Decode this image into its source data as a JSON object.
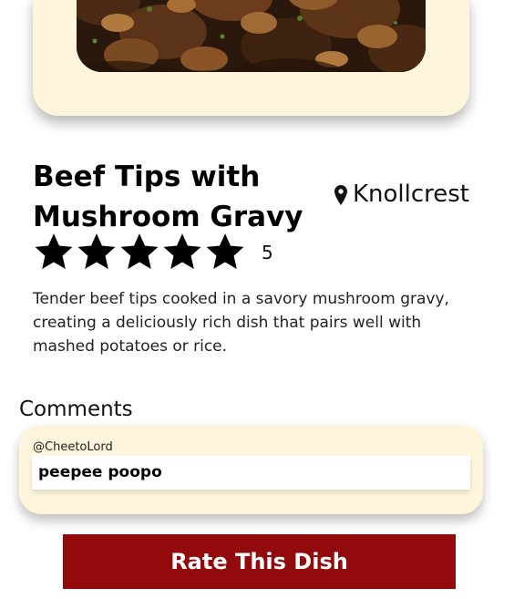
{
  "dish": {
    "title": "Beef Tips with Mushroom Gravy",
    "location": "Knollcrest",
    "location_icon": "map-pin-icon",
    "photo_alt": "Beef tips with mushroom gravy",
    "rating": {
      "stars_filled": 5,
      "stars_total": 5,
      "value": "5",
      "star_icon": "star-icon"
    },
    "description": "Tender beef tips cooked in a savory mushroom gravy, creating a deliciously rich dish that pairs well with mashed potatoes or rice."
  },
  "comments": {
    "heading": "Comments",
    "items": [
      {
        "user": "@CheetoLord",
        "text": "peepee poopo"
      }
    ]
  },
  "actions": {
    "rate_label": "Rate This Dish"
  },
  "colors": {
    "card_background": "#fff5dc",
    "button_background": "#930a0c",
    "button_text": "#ffffff"
  }
}
